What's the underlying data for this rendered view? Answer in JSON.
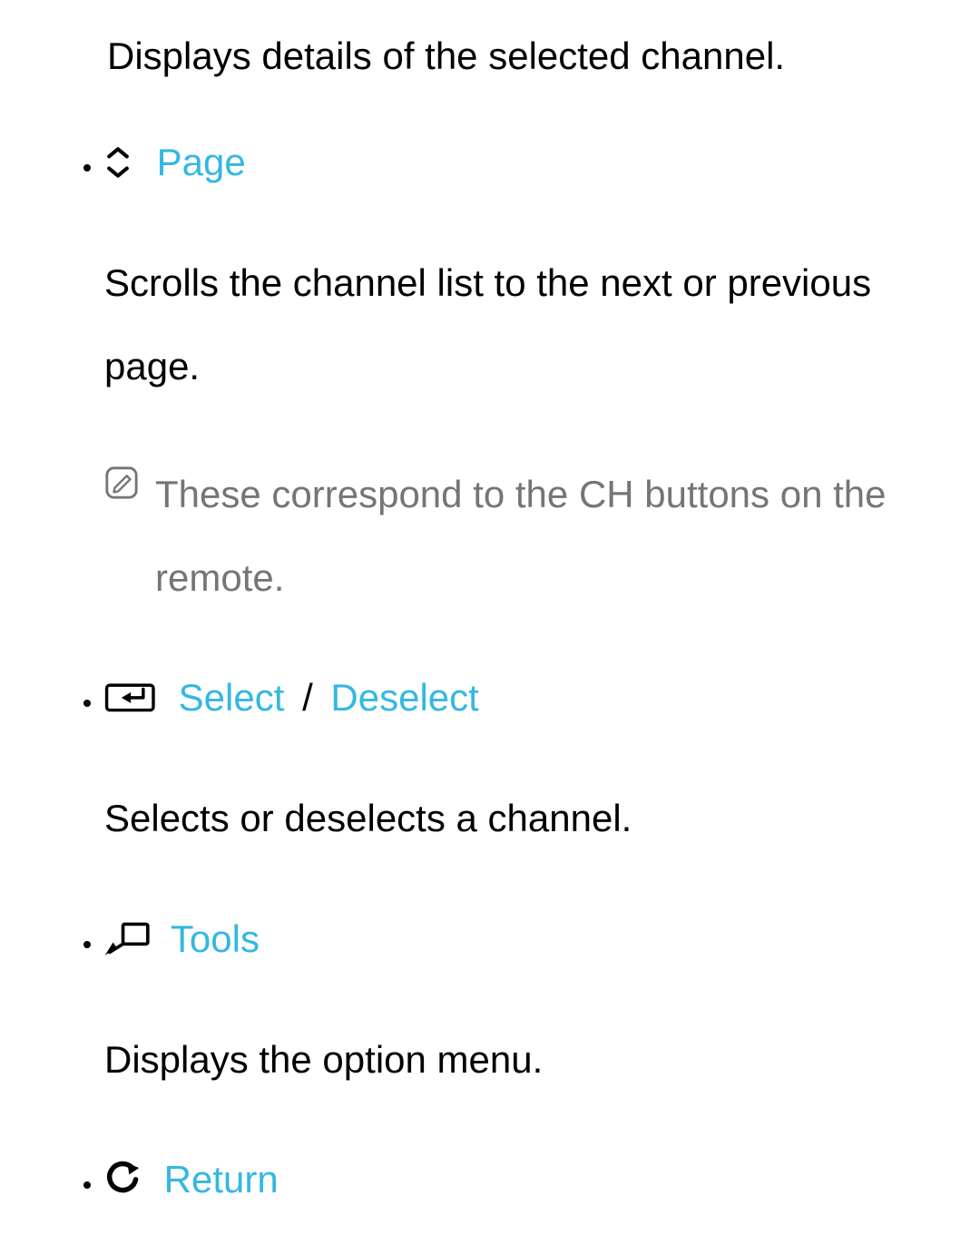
{
  "intro": "Displays details of the selected channel.",
  "items": [
    {
      "label": "Page",
      "desc": "Scrolls the channel list to the next or previous page.",
      "note": "These correspond to the CH buttons on the remote."
    },
    {
      "label": "Select",
      "label2": "Deselect",
      "sep": "/",
      "desc": "Selects or deselects a channel."
    },
    {
      "label": "Tools",
      "desc": "Displays the option menu."
    },
    {
      "label": "Return"
    }
  ]
}
